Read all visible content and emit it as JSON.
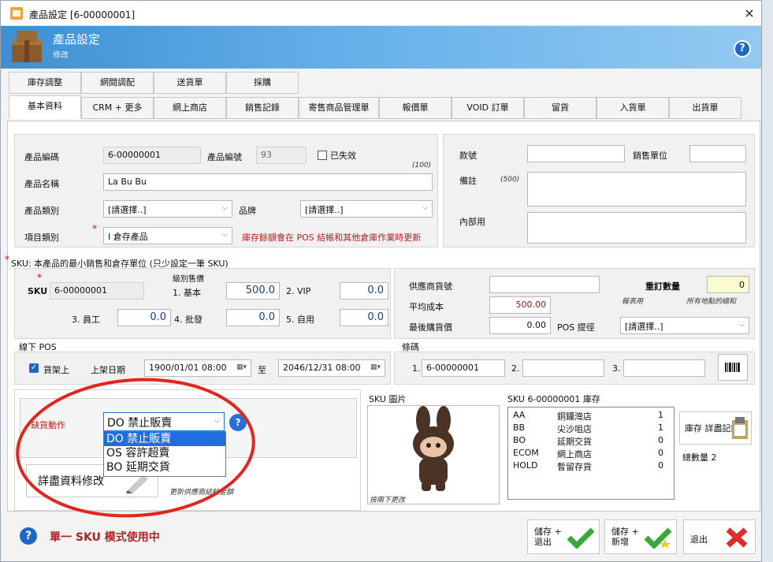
{
  "window": {
    "title": "產品設定 [6-00000001]",
    "close": "×"
  },
  "banner": {
    "title": "產品設定",
    "subtitle": "修改",
    "help": "?"
  },
  "tabs_row1": [
    "庫存調整",
    "網間調配",
    "送貨單",
    "採購"
  ],
  "tabs_row2": [
    "基本資料",
    "CRM + 更多",
    "網上商店",
    "銷售記錄",
    "寄售商品管理單",
    "報價單",
    "VOID 訂單",
    "留貨",
    "入貨單",
    "出貨單"
  ],
  "basic": {
    "code_label": "產品編碼",
    "code_value": "6-00000001",
    "num_label": "產品編號",
    "num_value": "93",
    "inactive_label": "已失效",
    "name_label": "產品名稱",
    "name_value": "La Bu Bu",
    "name_limit": "(100)",
    "category_label": "產品類別",
    "category_value": "[請選擇..]",
    "brand_label": "品牌",
    "brand_value": "[請選擇..]",
    "item_type_label": "項目類別",
    "item_type_value": "I 倉存產品",
    "item_type_hint": "庫存餘額會在 POS 結帳和其他倉庫作業時更新"
  },
  "right_panel": {
    "style_label": "款號",
    "style_value": "",
    "unit_label": "銷售單位",
    "unit_value": "",
    "remark_label": "備註",
    "remark_limit": "(500)",
    "remark_value": "",
    "internal_label": "內部用",
    "internal_value": ""
  },
  "sku": {
    "section_title": "SKU: 本產品的最小銷售和倉存單位  (只少設定一筆 SKU)",
    "sku_label": "SKU",
    "sku_value": "6-00000001",
    "price_level_label": "級別售價",
    "p1_label": "1. 基本",
    "p1_value": "500.0",
    "p2_label": "2. VIP",
    "p2_value": "0.0",
    "p3_label": "3. 員工",
    "p3_value": "0.0",
    "p4_label": "4. 批發",
    "p4_value": "0.0",
    "p5_label": "5. 自用",
    "p5_value": "0.0",
    "supplier_code_label": "供應商貨號",
    "supplier_code_value": "",
    "reorder_label": "重訂數量",
    "reorder_value": "0",
    "report_note": "報表用",
    "all_locations_note": "所有地點的總和",
    "avg_cost_label": "平均成本",
    "avg_cost_value": "500.00",
    "last_cost_label": "最後購貨價",
    "last_cost_value": "0.00",
    "pos_hint_label": "POS 提徑",
    "pos_hint_value": "[請選擇..]"
  },
  "pos": {
    "section_title": "線下 POS",
    "listed_label": "貨架上",
    "date_label": "上架日期",
    "from": "1900/01/01 08:00",
    "to_label": "至",
    "to": "2046/12/31 08:00"
  },
  "barcode": {
    "section_title": "條碼",
    "b1_label": "1.",
    "b1_value": "6-00000001",
    "b2_label": "2.",
    "b2_value": "",
    "b3_label": "3.",
    "b3_value": ""
  },
  "stockout": {
    "label": "缺貨動作",
    "selected": "DO 禁止販賣",
    "options": [
      "DO 禁止販賣",
      "OS 容許超賣",
      "BO 延期交貨"
    ],
    "edit_button": "詳盡資料修改",
    "supplier_note": "更新供應商結餘金額"
  },
  "image": {
    "section_title": "SKU 圖片",
    "note": "按兩下更改"
  },
  "inventory": {
    "section_title": "SKU 6-00000001 庫存",
    "rows": [
      {
        "code": "AA",
        "name": "銅鑼灣店",
        "qty": "1"
      },
      {
        "code": "BB",
        "name": "尖沙咀店",
        "qty": "1"
      },
      {
        "code": "BO",
        "name": "延期交貨",
        "qty": "0"
      },
      {
        "code": "ECOM",
        "name": "網上商店",
        "qty": "0"
      },
      {
        "code": "HOLD",
        "name": "暫留存貨",
        "qty": "0"
      }
    ],
    "detail_button": "庫存 詳盡記錄",
    "total_label": "總數量 2"
  },
  "status": {
    "mode_text": "單一 SKU 模式使用中",
    "save_exit": "儲存 +\n退出",
    "save_new": "儲存 +\n新增",
    "exit": "退出"
  },
  "colors": {
    "accent": "#3f8fd0",
    "warning_text": "#b22222",
    "highlight": "#fbfbd0",
    "annotation": "#e0261f"
  }
}
